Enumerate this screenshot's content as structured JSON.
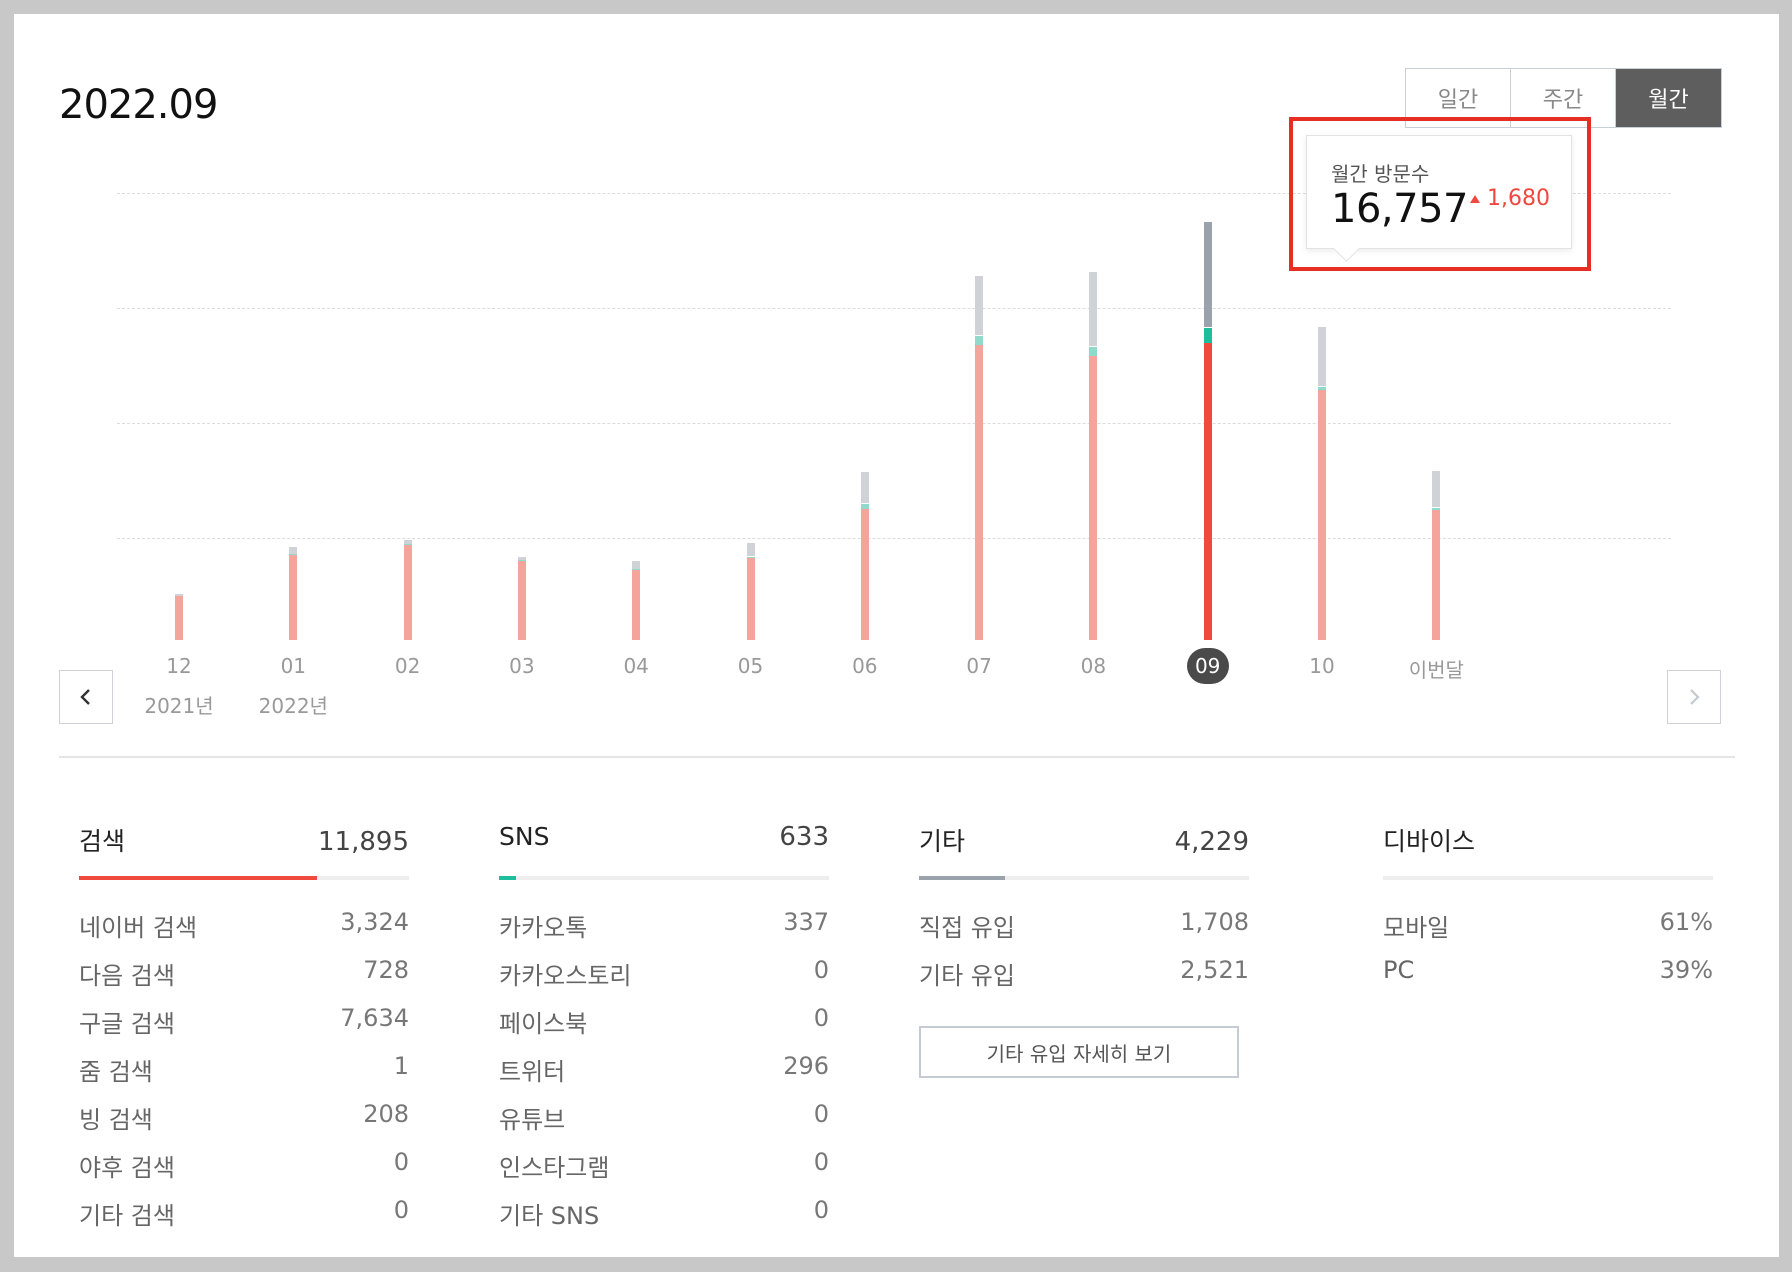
{
  "header": {
    "period": "2022.09"
  },
  "tabs": [
    {
      "label": "일간",
      "active": false
    },
    {
      "label": "주간",
      "active": false
    },
    {
      "label": "월간",
      "active": true
    }
  ],
  "tooltip": {
    "label": "월간 방문수",
    "value": "16,757",
    "delta": "1,680"
  },
  "chart_data": {
    "type": "bar",
    "stacked": true,
    "title": "",
    "xlabel": "",
    "ylabel": "",
    "grid": true,
    "categories": [
      "12",
      "01",
      "02",
      "03",
      "04",
      "05",
      "06",
      "07",
      "08",
      "09",
      "10",
      "이번달"
    ],
    "year_labels": {
      "12": "2021년",
      "01": "2022년"
    },
    "selected": "09",
    "series": [
      {
        "values": [
          1750,
          3400,
          3800,
          3150,
          2800,
          3300,
          5250,
          11800,
          11350,
          11895,
          10000,
          5200
        ],
        "color": "#f5a49c",
        "selected_color": "#f04a3e"
      },
      {
        "values": [
          30,
          60,
          60,
          50,
          40,
          60,
          230,
          400,
          400,
          633,
          150,
          120
        ],
        "color": "#8fdacb",
        "selected_color": "#1ebd9c"
      },
      {
        "values": [
          100,
          300,
          180,
          150,
          350,
          550,
          1300,
          2400,
          3000,
          4229,
          2400,
          1500
        ],
        "color": "#cfd3d7",
        "selected_color": "#9aa2ab"
      }
    ],
    "ylim": [
      0,
      20000
    ]
  },
  "stats": {
    "search": {
      "title": "검색",
      "total": "11,895",
      "color": "#f04a3e",
      "fill": 0.72,
      "rows": [
        {
          "label": "네이버 검색",
          "value": "3,324"
        },
        {
          "label": "다음 검색",
          "value": "728"
        },
        {
          "label": "구글 검색",
          "value": "7,634"
        },
        {
          "label": "줌 검색",
          "value": "1"
        },
        {
          "label": "빙 검색",
          "value": "208"
        },
        {
          "label": "야후 검색",
          "value": "0"
        },
        {
          "label": "기타 검색",
          "value": "0"
        }
      ]
    },
    "sns": {
      "title": "SNS",
      "total": "633",
      "color": "#1ebd9c",
      "fill": 0.05,
      "rows": [
        {
          "label": "카카오톡",
          "value": "337"
        },
        {
          "label": "카카오스토리",
          "value": "0"
        },
        {
          "label": "페이스북",
          "value": "0"
        },
        {
          "label": "트위터",
          "value": "296"
        },
        {
          "label": "유튜브",
          "value": "0"
        },
        {
          "label": "인스타그램",
          "value": "0"
        },
        {
          "label": "기타 SNS",
          "value": "0"
        }
      ]
    },
    "etc": {
      "title": "기타",
      "total": "4,229",
      "color": "#9aa2ab",
      "fill": 0.26,
      "rows": [
        {
          "label": "직접 유입",
          "value": "1,708"
        },
        {
          "label": "기타 유입",
          "value": "2,521"
        }
      ],
      "button": "기타 유입 자세히 보기"
    },
    "device": {
      "title": "디바이스",
      "rows": [
        {
          "label": "모바일",
          "value": "61%"
        },
        {
          "label": "PC",
          "value": "39%"
        }
      ]
    }
  },
  "icons": {
    "prev": "chevron-left-icon",
    "next": "chevron-right-icon",
    "delta": "triangle-up-icon"
  }
}
